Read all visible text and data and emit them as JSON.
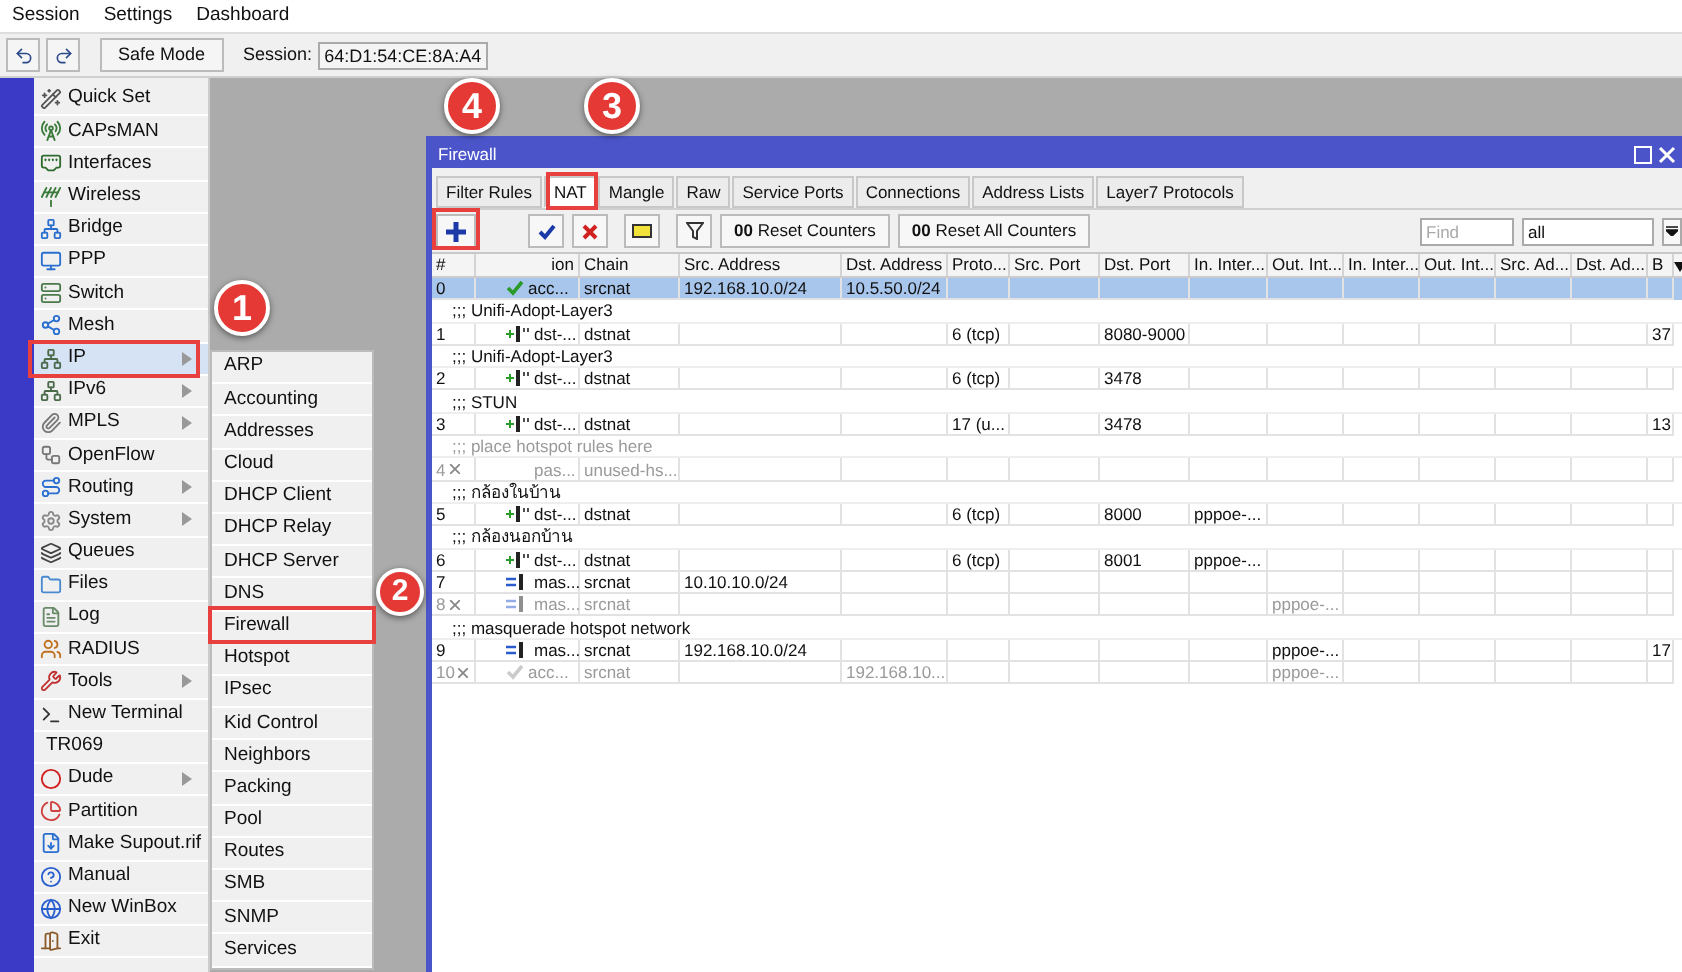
{
  "menu_bar": [
    "Session",
    "Settings",
    "Dashboard"
  ],
  "toolbar": {
    "safe_mode": "Safe Mode",
    "session_label": "Session:",
    "session_value": "64:D1:54:CE:8A:A4"
  },
  "sidebar": {
    "items": [
      {
        "label": "Quick Set",
        "selected": false,
        "submenu": false
      },
      {
        "label": "CAPsMAN",
        "selected": false,
        "submenu": false
      },
      {
        "label": "Interfaces",
        "selected": false,
        "submenu": false
      },
      {
        "label": "Wireless",
        "selected": false,
        "submenu": false
      },
      {
        "label": "Bridge",
        "selected": false,
        "submenu": false
      },
      {
        "label": "PPP",
        "selected": false,
        "submenu": false
      },
      {
        "label": "Switch",
        "selected": false,
        "submenu": false
      },
      {
        "label": "Mesh",
        "selected": false,
        "submenu": false
      },
      {
        "label": "IP",
        "selected": true,
        "submenu": true
      },
      {
        "label": "IPv6",
        "selected": false,
        "submenu": true
      },
      {
        "label": "MPLS",
        "selected": false,
        "submenu": true
      },
      {
        "label": "OpenFlow",
        "selected": false,
        "submenu": false
      },
      {
        "label": "Routing",
        "selected": false,
        "submenu": true
      },
      {
        "label": "System",
        "selected": false,
        "submenu": true
      },
      {
        "label": "Queues",
        "selected": false,
        "submenu": false
      },
      {
        "label": "Files",
        "selected": false,
        "submenu": false
      },
      {
        "label": "Log",
        "selected": false,
        "submenu": false
      },
      {
        "label": "RADIUS",
        "selected": false,
        "submenu": false
      },
      {
        "label": "Tools",
        "selected": false,
        "submenu": true
      },
      {
        "label": "New Terminal",
        "selected": false,
        "submenu": false
      },
      {
        "label": "TR069",
        "selected": false,
        "submenu": false
      },
      {
        "label": "Dude",
        "selected": false,
        "submenu": true
      },
      {
        "label": "Partition",
        "selected": false,
        "submenu": false
      },
      {
        "label": "Make Supout.rif",
        "selected": false,
        "submenu": false
      },
      {
        "label": "Manual",
        "selected": false,
        "submenu": false
      },
      {
        "label": "New WinBox",
        "selected": false,
        "submenu": false
      },
      {
        "label": "Exit",
        "selected": false,
        "submenu": false
      }
    ]
  },
  "submenu": {
    "items": [
      {
        "label": "ARP"
      },
      {
        "label": "Accounting"
      },
      {
        "label": "Addresses"
      },
      {
        "label": "Cloud"
      },
      {
        "label": "DHCP Client"
      },
      {
        "label": "DHCP Relay"
      },
      {
        "label": "DHCP Server"
      },
      {
        "label": "DNS"
      },
      {
        "label": "Firewall"
      },
      {
        "label": "Hotspot"
      },
      {
        "label": "IPsec"
      },
      {
        "label": "Kid Control"
      },
      {
        "label": "Neighbors"
      },
      {
        "label": "Packing"
      },
      {
        "label": "Pool"
      },
      {
        "label": "Routes"
      },
      {
        "label": "SMB"
      },
      {
        "label": "SNMP"
      },
      {
        "label": "Services"
      }
    ]
  },
  "firewall_window": {
    "title": "Firewall",
    "tabs": [
      {
        "label": "Filter Rules",
        "selected": false
      },
      {
        "label": "NAT",
        "selected": true
      },
      {
        "label": "Mangle",
        "selected": false
      },
      {
        "label": "Raw",
        "selected": false
      },
      {
        "label": "Service Ports",
        "selected": false
      },
      {
        "label": "Connections",
        "selected": false
      },
      {
        "label": "Address Lists",
        "selected": false
      },
      {
        "label": "Layer7 Protocols",
        "selected": false
      }
    ],
    "toolbar": {
      "reset_counters": "**00** Reset Counters",
      "reset_all_counters": "**00** Reset All Counters",
      "find_placeholder": "Find",
      "filter_value": "all"
    },
    "table": {
      "columns": [
        "#",
        "ion",
        "Chain",
        "Src. Address",
        "Dst. Address",
        "Proto...",
        "Src. Port",
        "Dst. Port",
        "In. Inter...",
        "Out. Int...",
        "In. Inter...",
        "Out. Int...",
        "Src. Ad...",
        "Dst. Ad...",
        "B"
      ],
      "rows": [
        {
          "kind": "accept",
          "number": "0",
          "disabled": false,
          "selected": true,
          "action": "acc...",
          "chain": "srcnat",
          "src_address": "192.168.10.0/24",
          "dst_address": "10.5.50.0/24"
        },
        {
          "kind": "comment",
          "text": ";;; Unifi-Adopt-Layer3",
          "disabled": false
        },
        {
          "kind": "dstnat",
          "number": "1",
          "disabled": false,
          "selected": false,
          "action": "dst-...",
          "chain": "dstnat",
          "protocol": "6 (tcp)",
          "dst_port": "8080-9000",
          "bytes": "37"
        },
        {
          "kind": "comment",
          "text": ";;; Unifi-Adopt-Layer3",
          "disabled": false
        },
        {
          "kind": "dstnat",
          "number": "2",
          "disabled": false,
          "selected": false,
          "action": "dst-...",
          "chain": "dstnat",
          "protocol": "6 (tcp)",
          "dst_port": "3478"
        },
        {
          "kind": "comment",
          "text": ";;; STUN",
          "disabled": false
        },
        {
          "kind": "dstnat",
          "number": "3",
          "disabled": false,
          "selected": false,
          "action": "dst-...",
          "chain": "dstnat",
          "protocol": "17 (u...",
          "dst_port": "3478",
          "bytes": "13"
        },
        {
          "kind": "comment",
          "text": ";;; place hotspot rules here",
          "disabled": true
        },
        {
          "kind": "passthrough",
          "number": "4",
          "disabled": true,
          "selected": false,
          "action": "pas...",
          "chain": "unused-hs..."
        },
        {
          "kind": "comment",
          "text": ";;; กล้องในบ้าน",
          "disabled": false
        },
        {
          "kind": "dstnat",
          "number": "5",
          "disabled": false,
          "selected": false,
          "action": "dst-...",
          "chain": "dstnat",
          "protocol": "6 (tcp)",
          "dst_port": "8000",
          "in_interface": "pppoe-..."
        },
        {
          "kind": "comment",
          "text": ";;; กล้องนอกบ้าน",
          "disabled": false
        },
        {
          "kind": "dstnat",
          "number": "6",
          "disabled": false,
          "selected": false,
          "action": "dst-...",
          "chain": "dstnat",
          "protocol": "6 (tcp)",
          "dst_port": "8001",
          "in_interface": "pppoe-..."
        },
        {
          "kind": "masquerade",
          "number": "7",
          "disabled": false,
          "selected": false,
          "action": "mas...",
          "chain": "srcnat",
          "src_address": "10.10.10.0/24"
        },
        {
          "kind": "masquerade",
          "number": "8",
          "disabled": true,
          "selected": false,
          "action": "mas...",
          "chain": "srcnat",
          "out_interface": "pppoe-..."
        },
        {
          "kind": "comment",
          "text": ";;; masquerade hotspot network",
          "disabled": false
        },
        {
          "kind": "masquerade",
          "number": "9",
          "disabled": false,
          "selected": false,
          "action": "mas...",
          "chain": "srcnat",
          "src_address": "192.168.10.0/24",
          "out_interface": "pppoe-...",
          "bytes": "17"
        },
        {
          "kind": "accept",
          "number": "10",
          "disabled": true,
          "selected": false,
          "action": "acc...",
          "chain": "srcnat",
          "dst_address": "192.168.10...",
          "out_interface": "pppoe-..."
        }
      ]
    }
  },
  "annotations": [
    {
      "label": "1"
    },
    {
      "label": "2"
    },
    {
      "label": "3"
    },
    {
      "label": "4"
    }
  ]
}
